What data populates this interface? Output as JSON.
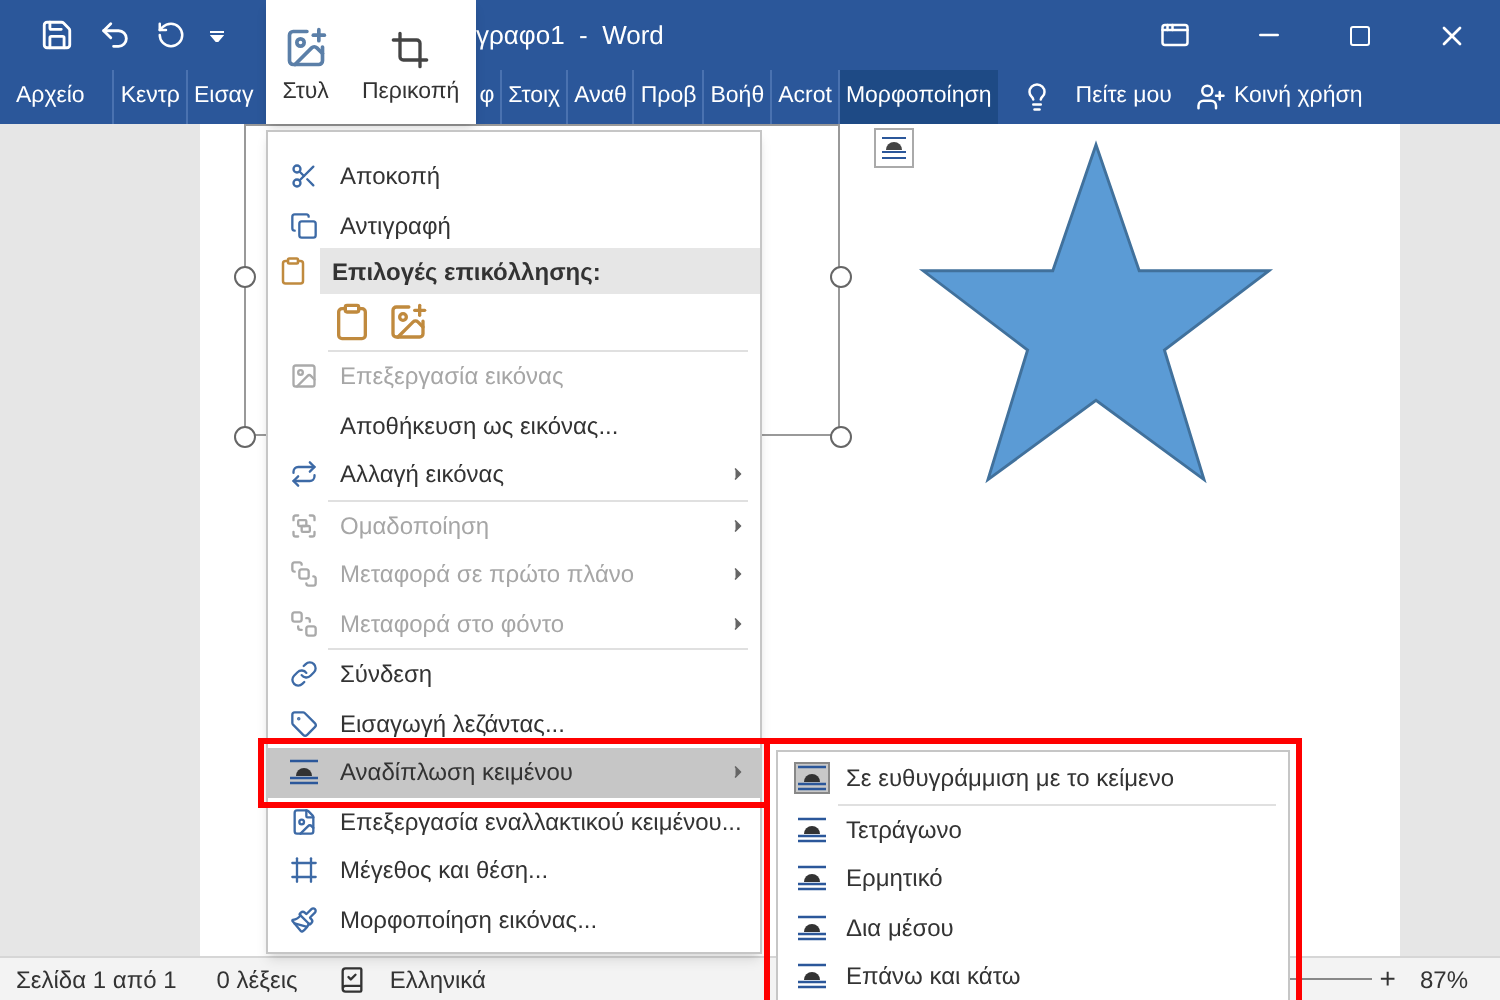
{
  "window": {
    "title": "γραφο1  -  Word"
  },
  "mini_toolbar": {
    "buttons": [
      "Στυλ",
      "Περικοπή"
    ]
  },
  "ribbon": {
    "tabs": [
      {
        "label": "Αρχείο",
        "selected": false
      },
      {
        "label": "Κεντρ",
        "selected": false
      },
      {
        "label": "Εισαγ",
        "selected": false
      },
      {
        "label": "φ",
        "selected": false
      },
      {
        "label": "Στοιχ",
        "selected": false
      },
      {
        "label": "Αναθ",
        "selected": false
      },
      {
        "label": "Προβ",
        "selected": false
      },
      {
        "label": "Βοήθ",
        "selected": false
      },
      {
        "label": "Acrot",
        "selected": false
      },
      {
        "label": "Μορφοποίηση",
        "selected": true
      }
    ],
    "tell_me": "Πείτε μου",
    "share": "Κοινή χρήση"
  },
  "context_menu": {
    "items": [
      {
        "kind": "item",
        "label": "Αποκοπή",
        "disabled": false,
        "submenu": false,
        "selected": false,
        "annotated": false
      },
      {
        "kind": "item",
        "label": "Αντιγραφή",
        "disabled": false,
        "submenu": false,
        "selected": false,
        "annotated": false
      },
      {
        "kind": "header",
        "label": "Επιλογές επικόλλησης:"
      },
      {
        "kind": "paste_options"
      },
      {
        "kind": "separator"
      },
      {
        "kind": "item",
        "label": "Επεξεργασία εικόνας",
        "disabled": true,
        "submenu": false,
        "selected": false,
        "annotated": false
      },
      {
        "kind": "item",
        "label": "Αποθήκευση ως εικόνας...",
        "disabled": false,
        "submenu": false,
        "selected": false,
        "annotated": false
      },
      {
        "kind": "item",
        "label": "Αλλαγή εικόνας",
        "disabled": false,
        "submenu": true,
        "selected": false,
        "annotated": false
      },
      {
        "kind": "separator"
      },
      {
        "kind": "item",
        "label": "Ομαδοποίηση",
        "disabled": true,
        "submenu": true,
        "selected": false,
        "annotated": false
      },
      {
        "kind": "item",
        "label": "Μεταφορά σε πρώτο πλάνο",
        "disabled": true,
        "submenu": true,
        "selected": false,
        "annotated": false
      },
      {
        "kind": "item",
        "label": "Μεταφορά στο φόντο",
        "disabled": true,
        "submenu": true,
        "selected": false,
        "annotated": false
      },
      {
        "kind": "separator"
      },
      {
        "kind": "item",
        "label": "Σύνδεση",
        "disabled": false,
        "submenu": false,
        "selected": false,
        "annotated": false
      },
      {
        "kind": "item",
        "label": "Εισαγωγή λεζάντας...",
        "disabled": false,
        "submenu": false,
        "selected": false,
        "annotated": false
      },
      {
        "kind": "item",
        "label": "Αναδίπλωση κειμένου",
        "disabled": false,
        "submenu": true,
        "selected": true,
        "annotated": true
      },
      {
        "kind": "item",
        "label": "Επεξεργασία εναλλακτικού κειμένου...",
        "disabled": false,
        "submenu": false,
        "selected": false,
        "annotated": false
      },
      {
        "kind": "item",
        "label": "Μέγεθος και θέση...",
        "disabled": false,
        "submenu": false,
        "selected": false,
        "annotated": false
      },
      {
        "kind": "item",
        "label": "Μορφοποίηση εικόνας...",
        "disabled": false,
        "submenu": false,
        "selected": false,
        "annotated": false
      }
    ]
  },
  "submenu": {
    "annotated": true,
    "items": [
      {
        "label": "Σε ευθυγράμμιση με το κείμενο",
        "selected": true
      },
      {
        "label": "Τετράγωνο",
        "selected": false
      },
      {
        "label": "Ερμητικό",
        "selected": false
      },
      {
        "label": "Δια μέσου",
        "selected": false
      },
      {
        "label": "Επάνω και κάτω",
        "selected": false
      }
    ]
  },
  "status_bar": {
    "page": "Σελίδα 1 από 1",
    "words": "0 λέξεις",
    "language": "Ελληνικά",
    "zoom_plus": "+",
    "zoom": "87%"
  }
}
